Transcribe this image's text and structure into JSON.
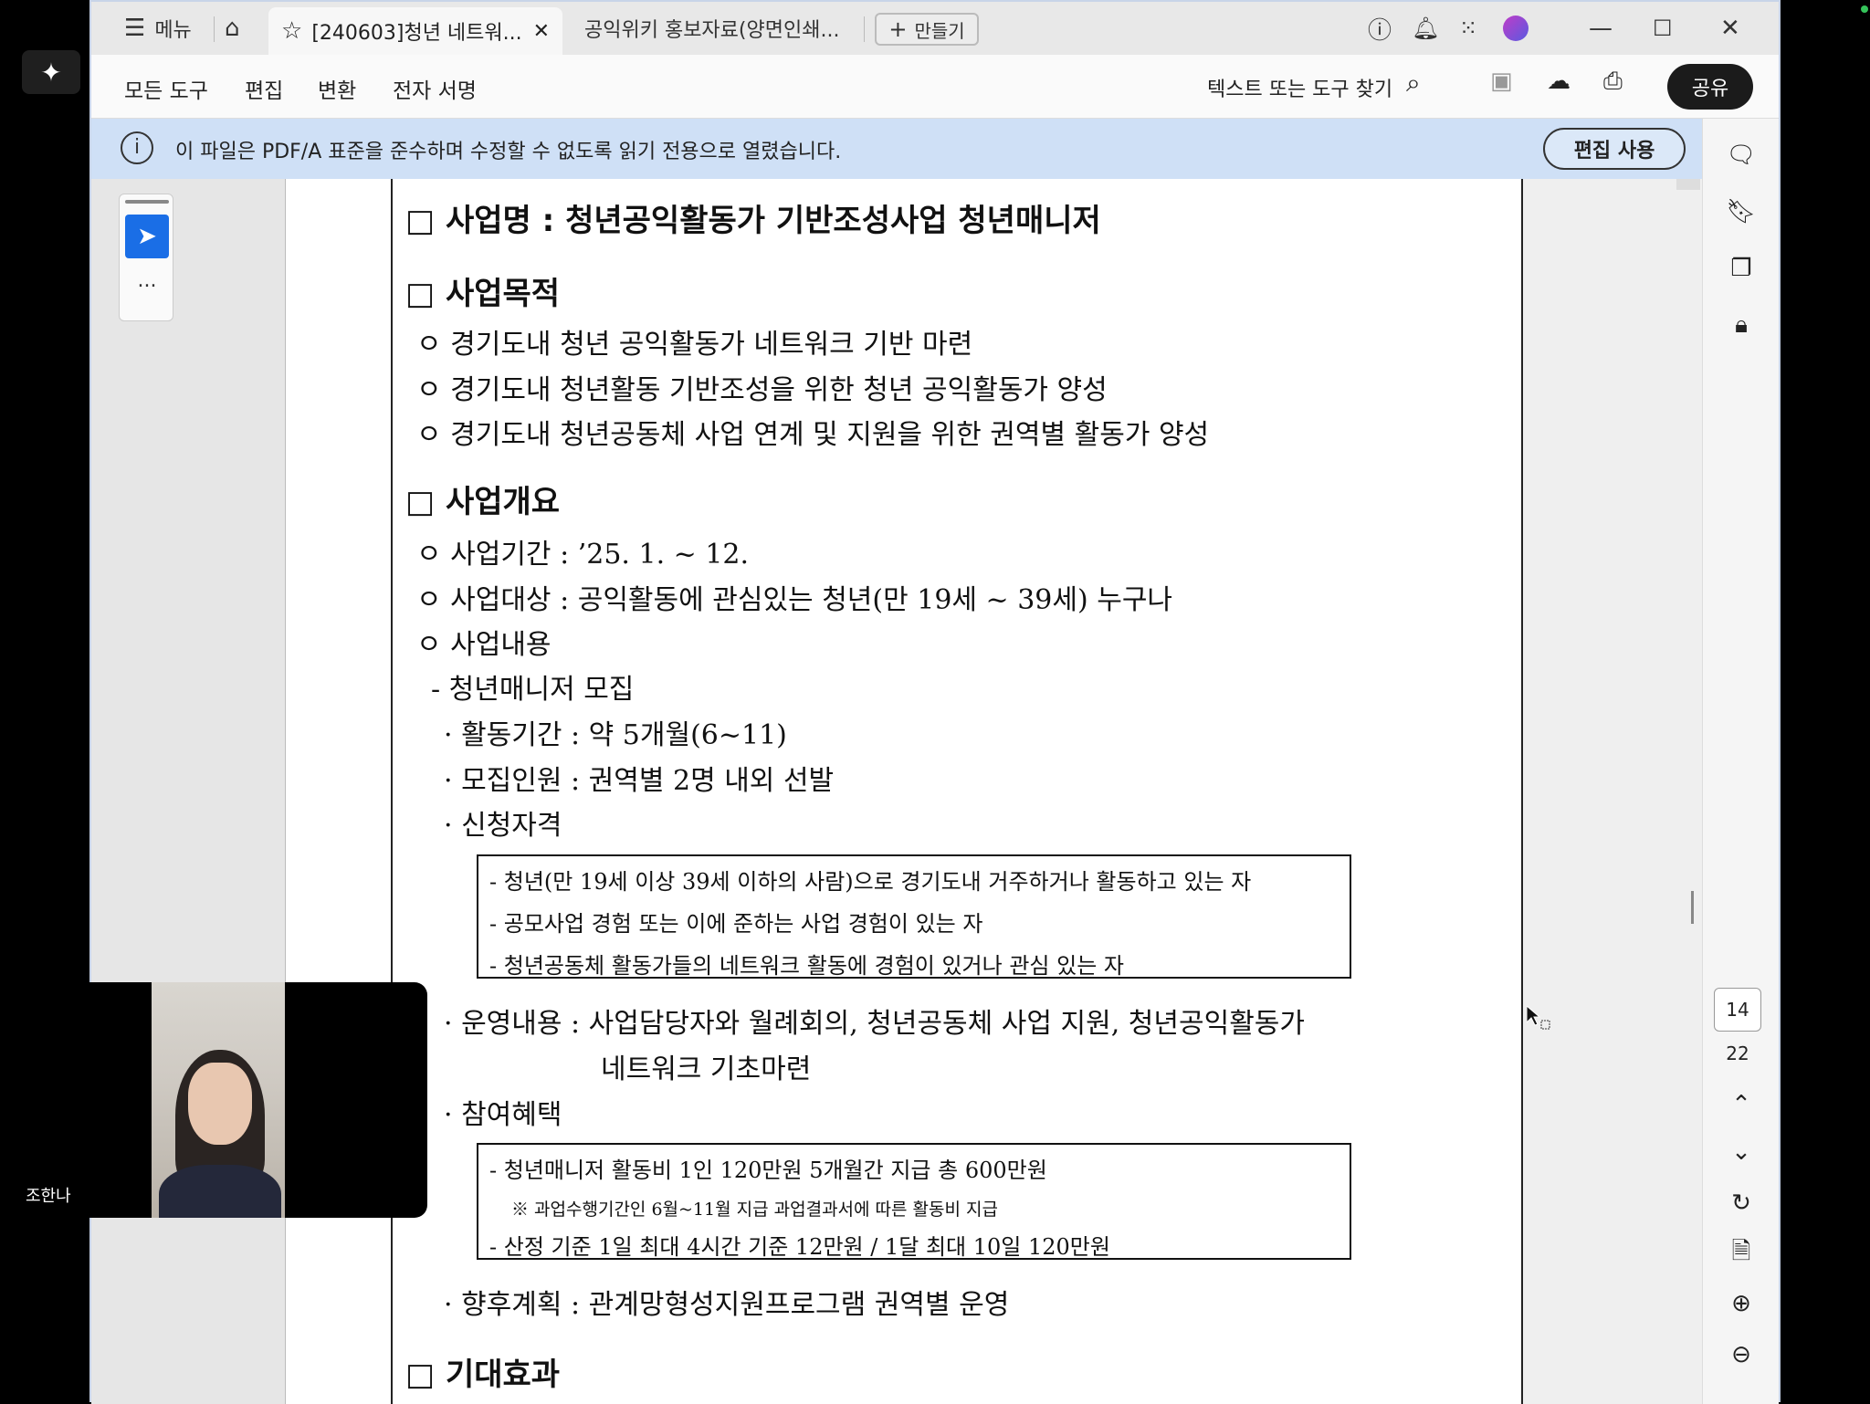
{
  "tabbar": {
    "menu_label": "메뉴",
    "active_tab": "[240603]청년 네트워...",
    "tab2": "공익위키 홍보자료(양면인쇄...",
    "new_tab_label": "만들기"
  },
  "toolbar": {
    "menus": [
      "모든 도구",
      "편집",
      "변환",
      "전자 서명"
    ],
    "search_label": "텍스트 또는 도구 찾기",
    "share_label": "공유"
  },
  "infobar": {
    "message": "이 파일은 PDF/A 표준을 준수하며 수정할 수 없도록 읽기 전용으로 열렸습니다.",
    "edit_button": "편집 사용"
  },
  "left_tools": {
    "more": "..."
  },
  "page_nav": {
    "current": "14",
    "total": "22"
  },
  "video": {
    "name": "조한나"
  },
  "document": {
    "h1": "□  사업명 : 청년공익활동가 기반조성사업 청년매니저",
    "h2": "□  사업목적",
    "p1": "ㅇ 경기도내 청년 공익활동가 네트워크 기반 마련",
    "p2": "ㅇ 경기도내 청년활동 기반조성을 위한 청년 공익활동가 양성",
    "p3": "ㅇ 경기도내 청년공동체 사업 연계 및 지원을 위한 권역별 활동가 양성",
    "h3": "□  사업개요",
    "q1": "ㅇ 사업기간 : ’25. 1. ~ 12.",
    "q2": "ㅇ 사업대상 : 공익활동에 관심있는 청년(만 19세 ~ 39세) 누구나",
    "q3": "ㅇ 사업내용",
    "r1": "- 청년매니저 모집",
    "r2": "· 활동기간 : 약 5개월(6~11)",
    "r3": "· 모집인원 : 권역별 2명 내외 선발",
    "r4": "· 신청자격",
    "box1": [
      "- 청년(만 19세 이상 39세 이하의 사람)으로 경기도내 거주하거나 활동하고 있는 자",
      "- 공모사업 경험 또는 이에 준하는 사업 경험이 있는 자",
      "- 청년공동체 활동가들의 네트워크 활동에 경험이 있거나 관심 있는 자"
    ],
    "r5": "· 운영내용 : 사업담당자와 월례회의, 청년공동체 사업 지원, 청년공익활동가",
    "r5b": "네트워크 기초마련",
    "r6": "· 참여혜택",
    "box2a": "- 청년매니저 활동비 1인 120만원 5개월간 지급 총 600만원",
    "box2b": "※ 과업수행기간인 6월~11월 지급 과업결과서에 따른 활동비 지급",
    "box2c": "- 산정 기준 1일 최대 4시간 기준 12만원 / 1달 최대 10일 120만원",
    "r7": "· 향후계획 : 관계망형성지원프로그램 권역별 운영",
    "h4": "□  기대효과"
  }
}
